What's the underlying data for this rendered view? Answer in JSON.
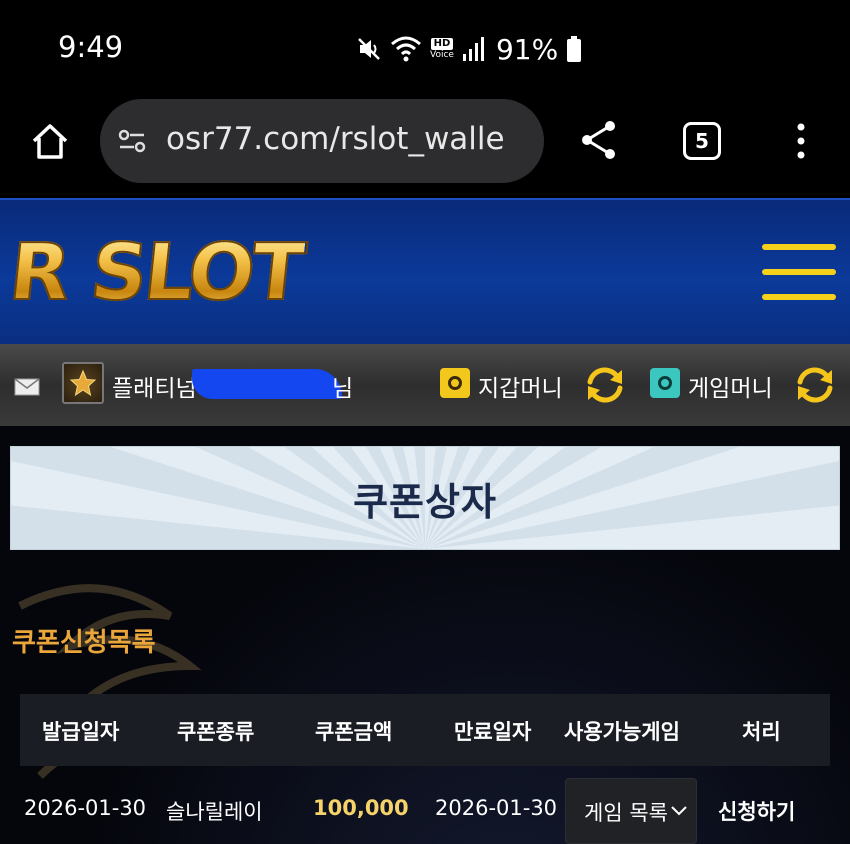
{
  "status_bar": {
    "time": "9:49",
    "hd_label": "HD",
    "voice_label": "Voice",
    "battery": "91%"
  },
  "browser": {
    "url": "osr77.com/rslot_walle",
    "tab_count": "5"
  },
  "site": {
    "logo_text": "R SLOT",
    "accent_color": "#f5d11c"
  },
  "userbar": {
    "rank_name": "플래티넘",
    "rank_suffix": "님",
    "wallet_label": "지갑머니",
    "game_money_label": "게임머니"
  },
  "main": {
    "banner_title": "쿠폰상자",
    "section_title": "쿠폰신청목록",
    "table": {
      "headers": [
        "발급일자",
        "쿠폰종류",
        "쿠폰금액",
        "만료일자",
        "사용가능게임",
        "처리"
      ],
      "rows": [
        {
          "issue_date": "2026-01-30",
          "coupon_type": "슬나릴레이",
          "amount": "100,000",
          "expiry_date": "2026-01-30",
          "game_select": "게임 목록",
          "action": "신청하기"
        }
      ]
    }
  }
}
